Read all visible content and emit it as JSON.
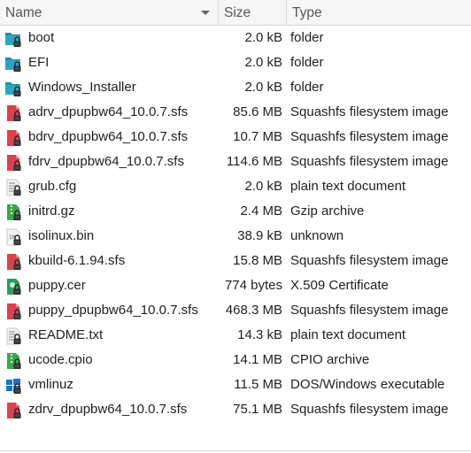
{
  "columns": {
    "name": "Name",
    "size": "Size",
    "type": "Type"
  },
  "files": [
    {
      "name": "boot",
      "size": "2.0 kB",
      "type": "folder",
      "icon": "folder-icon"
    },
    {
      "name": "EFI",
      "size": "2.0 kB",
      "type": "folder",
      "icon": "folder-icon"
    },
    {
      "name": "Windows_Installer",
      "size": "2.0 kB",
      "type": "folder",
      "icon": "folder-icon"
    },
    {
      "name": "adrv_dpupbw64_10.0.7.sfs",
      "size": "85.6 MB",
      "type": "Squashfs filesystem image",
      "icon": "squashfs-icon"
    },
    {
      "name": "bdrv_dpupbw64_10.0.7.sfs",
      "size": "10.7 MB",
      "type": "Squashfs filesystem image",
      "icon": "squashfs-icon"
    },
    {
      "name": "fdrv_dpupbw64_10.0.7.sfs",
      "size": "114.6 MB",
      "type": "Squashfs filesystem image",
      "icon": "squashfs-icon"
    },
    {
      "name": "grub.cfg",
      "size": "2.0 kB",
      "type": "plain text document",
      "icon": "text-file-icon"
    },
    {
      "name": "initrd.gz",
      "size": "2.4 MB",
      "type": "Gzip archive",
      "icon": "archive-icon"
    },
    {
      "name": "isolinux.bin",
      "size": "38.9 kB",
      "type": "unknown",
      "icon": "binary-file-icon"
    },
    {
      "name": "kbuild-6.1.94.sfs",
      "size": "15.8 MB",
      "type": "Squashfs filesystem image",
      "icon": "squashfs-icon"
    },
    {
      "name": "puppy.cer",
      "size": "774 bytes",
      "type": "X.509 Certificate",
      "icon": "certificate-icon"
    },
    {
      "name": "puppy_dpupbw64_10.0.7.sfs",
      "size": "468.3 MB",
      "type": "Squashfs filesystem image",
      "icon": "squashfs-icon"
    },
    {
      "name": "README.txt",
      "size": "14.3 kB",
      "type": "plain text document",
      "icon": "text-file-icon"
    },
    {
      "name": "ucode.cpio",
      "size": "14.1 MB",
      "type": "CPIO archive",
      "icon": "archive-icon"
    },
    {
      "name": "vmlinuz",
      "size": "11.5 MB",
      "type": "DOS/Windows executable",
      "icon": "windows-executable-icon"
    },
    {
      "name": "zdrv_dpupbw64_10.0.7.sfs",
      "size": "75.1 MB",
      "type": "Squashfs filesystem image",
      "icon": "squashfs-icon"
    }
  ],
  "colors": {
    "folder": "#1e8fa8",
    "squashfs": "#d9424f",
    "archive": "#3aa84a",
    "text": "#9a9a9a",
    "lock": "#2a2a2a"
  }
}
